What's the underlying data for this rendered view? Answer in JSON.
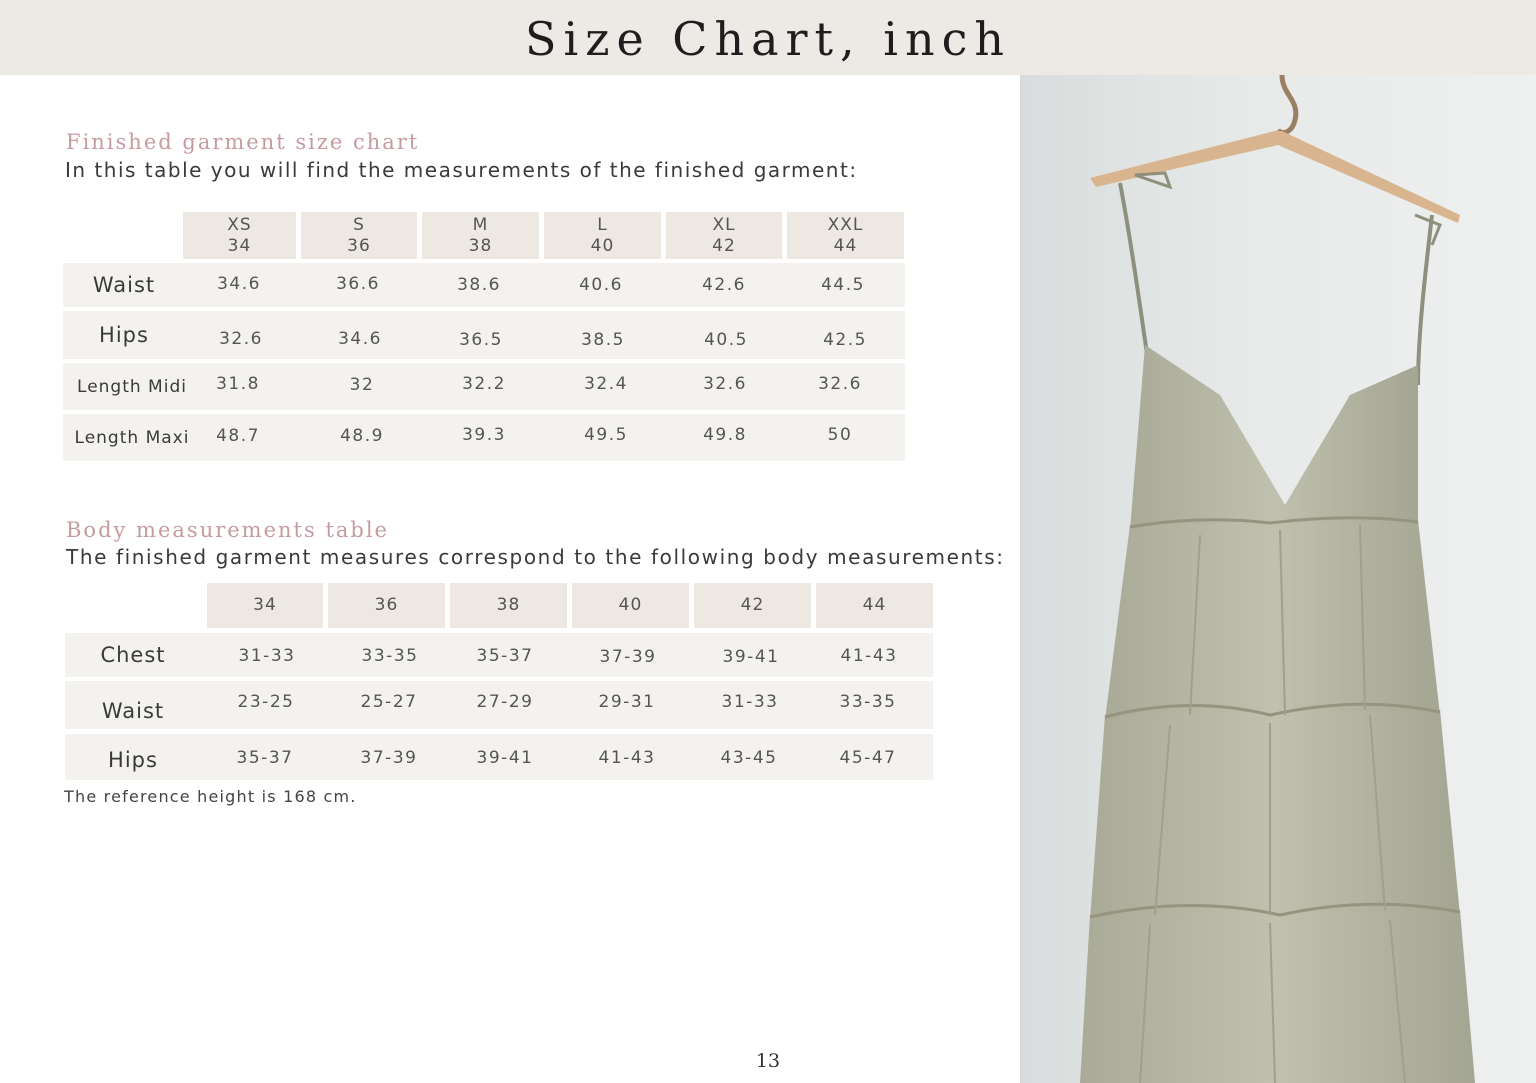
{
  "header": {
    "title": "Size Chart, inch"
  },
  "garment": {
    "title": "Finished garment size chart",
    "subtitle": "In this table you will find the measurements of the finished garment:",
    "sizes": [
      {
        "label": "XS",
        "num": "34"
      },
      {
        "label": "S",
        "num": "36"
      },
      {
        "label": "M",
        "num": "38"
      },
      {
        "label": "L",
        "num": "40"
      },
      {
        "label": "XL",
        "num": "42"
      },
      {
        "label": "XXL",
        "num": "44"
      }
    ],
    "rows": [
      {
        "label": "Waist",
        "values": [
          "34.6",
          "36.6",
          "38.6",
          "40.6",
          "42.6",
          "44.5"
        ]
      },
      {
        "label": "Hips",
        "values": [
          "32.6",
          "34.6",
          "36.5",
          "38.5",
          "40.5",
          "42.5"
        ]
      },
      {
        "label": "Length Midi",
        "values": [
          "31.8",
          "32",
          "32.2",
          "32.4",
          "32.6",
          "32.6"
        ]
      },
      {
        "label": "Length Maxi",
        "values": [
          "48.7",
          "48.9",
          "39.3",
          "49.5",
          "49.8",
          "50"
        ]
      }
    ]
  },
  "body": {
    "title": "Body measurements table",
    "subtitle": "The finished garment measures correspond to the following body measurements:",
    "sizes": [
      "34",
      "36",
      "38",
      "40",
      "42",
      "44"
    ],
    "rows": [
      {
        "label": "Chest",
        "values": [
          "31-33",
          "33-35",
          "35-37",
          "37-39",
          "39-41",
          "41-43"
        ]
      },
      {
        "label": "Waist",
        "values": [
          "23-25",
          "25-27",
          "27-29",
          "29-31",
          "31-33",
          "33-35"
        ]
      },
      {
        "label": "Hips",
        "values": [
          "35-37",
          "37-39",
          "39-41",
          "41-43",
          "43-45",
          "45-47"
        ]
      }
    ],
    "note": "The reference height is 168 cm."
  },
  "page_number": "13",
  "colors": {
    "header_bg": "#ede9e4",
    "accent_title": "#c59ba1",
    "cell_bg": "#ede8e2",
    "row_bg": "#f4f2ef",
    "dress": "#b9b9a7"
  }
}
